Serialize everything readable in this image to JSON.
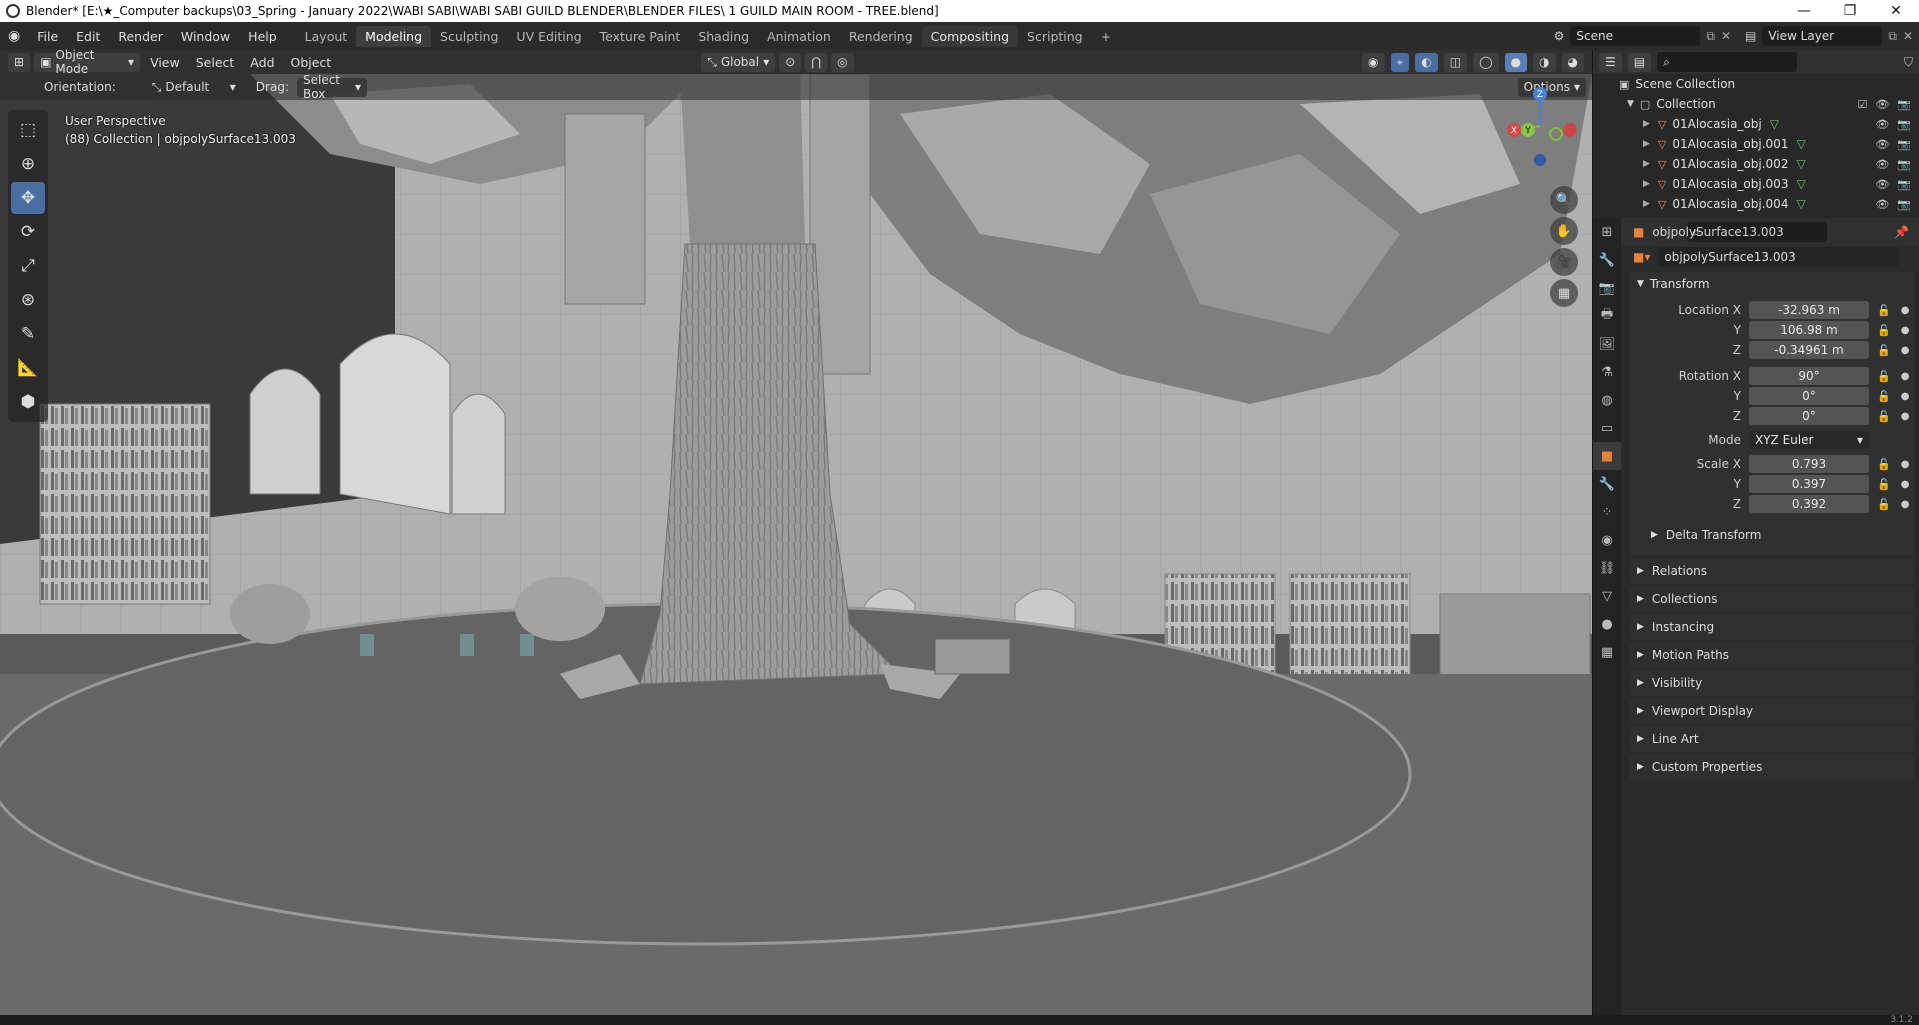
{
  "window": {
    "title": "Blender* [E:\\★_Computer backups\\03_Spring - January 2022\\WABI SABI\\WABI SABI GUILD BLENDER\\BLENDER FILES\\ 1 GUILD MAIN ROOM - TREE.blend]",
    "minimize": "—",
    "maximize": "❐",
    "close": "✕"
  },
  "menu": [
    "File",
    "Edit",
    "Render",
    "Window",
    "Help"
  ],
  "workspace_tabs": [
    "Layout",
    "Modeling",
    "Sculpting",
    "UV Editing",
    "Texture Paint",
    "Shading",
    "Animation",
    "Rendering",
    "Compositing",
    "Scripting"
  ],
  "add_tab": "+",
  "scene": {
    "label": "Scene",
    "view_layer": "View Layer"
  },
  "header": {
    "mode": "Object Mode",
    "items": [
      "View",
      "Select",
      "Add",
      "Object"
    ],
    "transform_space": "Global"
  },
  "tool_settings": {
    "orientation_label": "Orientation:",
    "orientation_value": "Default",
    "drag_label": "Drag:",
    "drag_value": "Select Box",
    "options": "Options"
  },
  "viewport": {
    "perspective": "User Perspective",
    "collection_info": "(88) Collection | objpolySurface13.003",
    "gizmo": {
      "x": "X",
      "y": "Y",
      "z": "Z"
    }
  },
  "outliner": {
    "scene_collection": "Scene Collection",
    "collection": "Collection",
    "items": [
      "01Alocasia_obj",
      "01Alocasia_obj.001",
      "01Alocasia_obj.002",
      "01Alocasia_obj.003",
      "01Alocasia_obj.004"
    ]
  },
  "properties": {
    "object_name": "objpolySurface13.003",
    "data_name": "objpolySurface13.003",
    "transform_title": "Transform",
    "location": {
      "label": "Location X",
      "x": "-32.963 m",
      "y": "106.98 m",
      "z": "-0.34961 m"
    },
    "rotation": {
      "label": "Rotation X",
      "x": "90°",
      "y": "0°",
      "z": "0°"
    },
    "mode_label": "Mode",
    "mode_value": "XYZ Euler",
    "scale": {
      "label": "Scale X",
      "x": "0.793",
      "y": "0.397",
      "z": "0.392"
    },
    "axis_y": "Y",
    "axis_z": "Z",
    "delta_transform": "Delta Transform",
    "panels": [
      "Relations",
      "Collections",
      "Instancing",
      "Motion Paths",
      "Visibility",
      "Viewport Display",
      "Line Art",
      "Custom Properties"
    ]
  },
  "status": {
    "version": "3.1.2"
  }
}
